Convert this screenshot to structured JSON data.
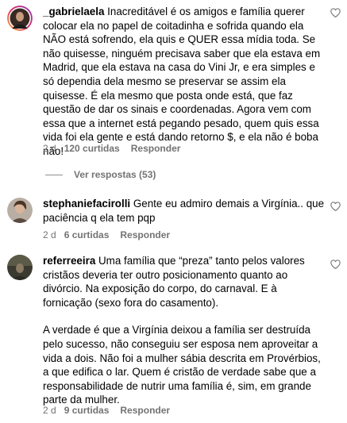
{
  "comments": [
    {
      "username": "_gabrielaela",
      "paragraphs": [
        "Inacreditável é os amigos e família querer colocar ela no papel de coitadinha e sofrida quando ela NÃO está sofrendo, ela quis e QUER essa mídia toda. Se não quisesse, ninguém precisava saber que ela estava em Madrid, que ela estava na casa do Vini Jr, e era simples e só dependia dela mesmo se preservar se assim ela quisesse. É ela mesmo que posta onde está, que faz questão de dar os sinais e coordenadas. Agora vem com essa que a internet está pegando pesado, quem quis essa vida foi ela gente e está dando retorno $, e ela não é boba não!"
      ],
      "time": "2 d",
      "likes": "120 curtidas",
      "reply_label": "Responder",
      "view_replies": "Ver respostas (53)"
    },
    {
      "username": "stephaniefacirolli",
      "paragraphs": [
        "Gente eu admiro demais a Virgínia.. que paciência q ela tem pqp"
      ],
      "time": "2 d",
      "likes": "6 curtidas",
      "reply_label": "Responder"
    },
    {
      "username": "referreeira",
      "paragraphs": [
        "Uma família que “preza” tanto pelos valores cristãos deveria ter outro posicionamento quanto ao divórcio. Na exposição do corpo, do carnaval. E à fornicação (sexo fora do casamento).",
        "A verdade é que a Virgínia deixou a família ser destruída pelo sucesso, não conseguiu ser esposa nem aproveitar a vida a dois. Não foi a mulher sábia descrita em Provérbios, a que edifica o lar. Quem é cristão de verdade sabe que a responsabilidade de nutrir uma família é, sim, em grande parte da mulher."
      ],
      "time": "2 d",
      "likes": "9 curtidas",
      "reply_label": "Responder"
    }
  ],
  "colors": {
    "text": "#000000",
    "meta": "#737373",
    "background": "#ffffff"
  },
  "icons": {
    "like": "heart-outline-icon"
  }
}
